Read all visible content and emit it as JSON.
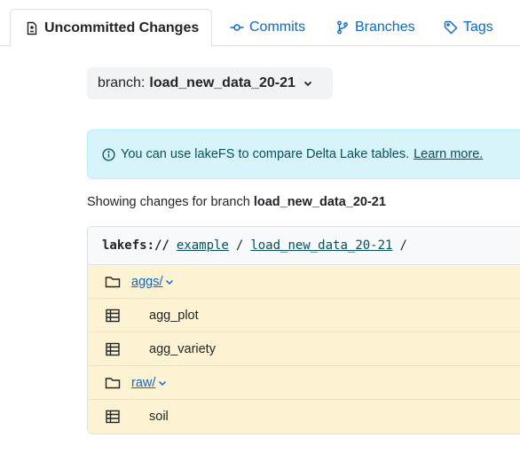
{
  "tabs": [
    {
      "label": "Uncommitted Changes",
      "icon": "file-diff-icon",
      "active": true
    },
    {
      "label": "Commits",
      "icon": "commit-icon",
      "active": false
    },
    {
      "label": "Branches",
      "icon": "branch-icon",
      "active": false
    },
    {
      "label": "Tags",
      "icon": "tag-icon",
      "active": false
    }
  ],
  "branch_selector": {
    "prefix": "branch:",
    "name": "load_new_data_20-21"
  },
  "alert": {
    "text": "You can use lakeFS to compare Delta Lake tables.",
    "link": "Learn more."
  },
  "showing": {
    "prefix": "Showing changes for branch",
    "branch": "load_new_data_20-21"
  },
  "path": {
    "root": "lakefs://",
    "repo": "example",
    "sep1": "/",
    "branch": "load_new_data_20-21",
    "sep2": "/"
  },
  "entries": [
    {
      "type": "directory",
      "name": "aggs/"
    },
    {
      "type": "table",
      "name": "agg_plot"
    },
    {
      "type": "table",
      "name": "agg_variety"
    },
    {
      "type": "directory",
      "name": "raw/"
    },
    {
      "type": "table",
      "name": "soil"
    }
  ],
  "colors": {
    "link": "#0b66d6",
    "row_bg": "#fdf3d2",
    "alert_bg": "#d6f4fa"
  }
}
